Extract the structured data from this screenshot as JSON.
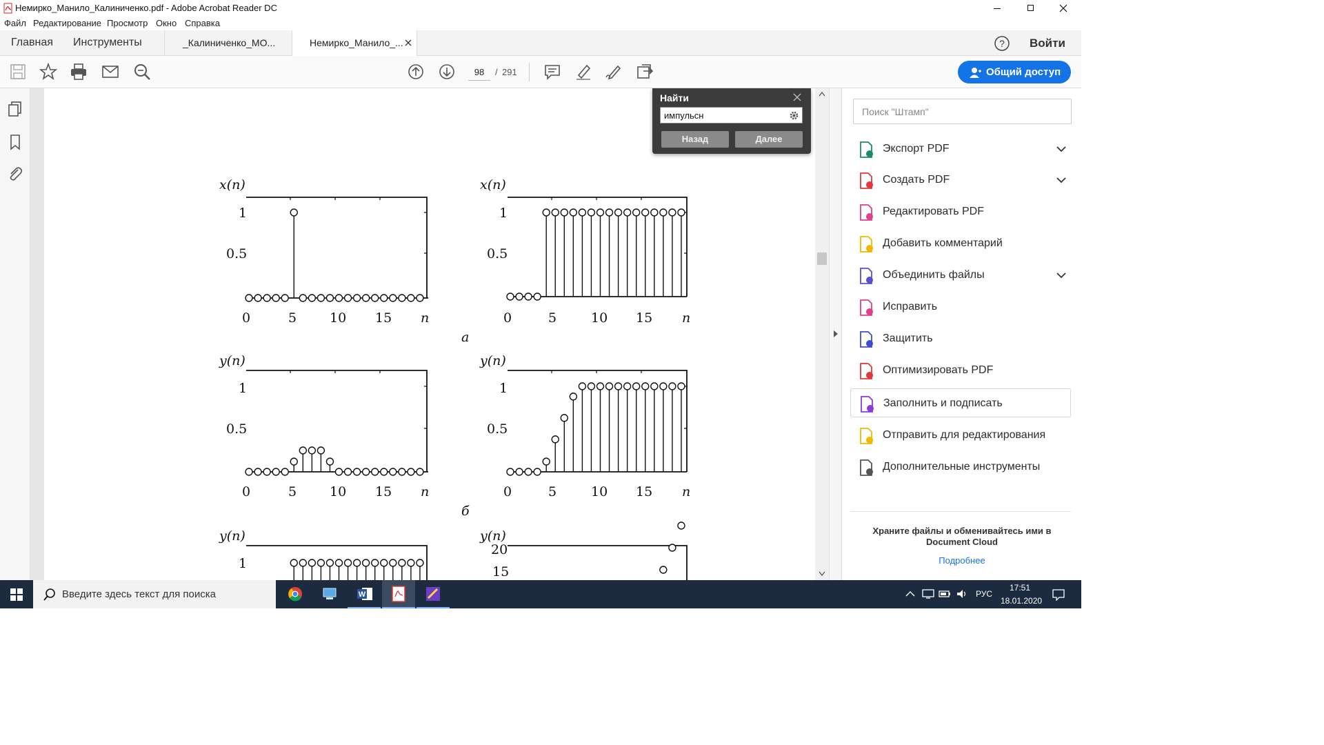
{
  "window": {
    "title": "Немирко_Манило_Калиниченко.pdf - Adobe Acrobat Reader DC"
  },
  "menu": [
    "Файл",
    "Редактирование",
    "Просмотр",
    "Окно",
    "Справка"
  ],
  "tabs": {
    "home": "Главная",
    "tools": "Инструменты",
    "doc1": "_Калиниченко_МО...",
    "doc2": "Немирко_Манило_...",
    "signin": "Войти"
  },
  "toolbar": {
    "page_current": "98",
    "page_sep": "/",
    "page_total": "291",
    "share_label": "Общий доступ"
  },
  "find": {
    "title": "Найти",
    "query": "импульсн",
    "prev": "Назад",
    "next": "Далее"
  },
  "rightpanel": {
    "search_placeholder": "Поиск \"Штамп\"",
    "tools": [
      {
        "label": "Экспорт PDF",
        "icon": "export-pdf-icon",
        "color": "#1b8a6b"
      },
      {
        "label": "Создать PDF",
        "icon": "create-pdf-icon",
        "color": "#e0383c"
      },
      {
        "label": "Редактировать PDF",
        "icon": "edit-pdf-icon",
        "color": "#e03f8e"
      },
      {
        "label": "Добавить комментарий",
        "icon": "comment-icon",
        "color": "#f0b800"
      },
      {
        "label": "Объединить файлы",
        "icon": "combine-files-icon",
        "color": "#5a4fcf"
      },
      {
        "label": "Исправить",
        "icon": "fix-icon",
        "color": "#e03f8e"
      },
      {
        "label": "Защитить",
        "icon": "protect-icon",
        "color": "#3d4fcf"
      },
      {
        "label": "Оптимизировать PDF",
        "icon": "optimize-pdf-icon",
        "color": "#e0383c"
      },
      {
        "label": "Заполнить и подписать",
        "icon": "fill-sign-icon",
        "color": "#8a3ed6"
      },
      {
        "label": "Отправить для редактирования",
        "icon": "send-review-icon",
        "color": "#f0b800"
      },
      {
        "label": "Дополнительные инструменты",
        "icon": "more-tools-icon",
        "color": "#555555"
      }
    ],
    "cloud_text": "Храните файлы и обменивайтесь ими в Document Cloud",
    "cloud_link": "Подробнее"
  },
  "taskbar": {
    "search_placeholder": "Введите здесь текст для поиска",
    "lang": "РУС",
    "time": "17:51",
    "date": "18.01.2020"
  },
  "document": {
    "caption_a": "а",
    "caption_b": "б",
    "xtick_labels": [
      "0",
      "5",
      "10",
      "15",
      "n"
    ],
    "plots": [
      {
        "ylabel": "x(n)",
        "yticks": [
          "1",
          "0.5"
        ],
        "x": [
          0,
          1,
          2,
          3,
          4,
          5,
          6,
          7,
          8,
          9,
          10,
          11,
          12,
          13,
          14,
          15,
          16,
          17,
          18,
          19
        ],
        "values": [
          0,
          0,
          0,
          0,
          0,
          1,
          0,
          0,
          0,
          0,
          0,
          0,
          0,
          0,
          0,
          0,
          0,
          0,
          0,
          0
        ]
      },
      {
        "ylabel": "x(n)",
        "yticks": [
          "1",
          "0.5"
        ],
        "x": [
          0,
          1,
          2,
          3,
          4,
          5,
          6,
          7,
          8,
          9,
          10,
          11,
          12,
          13,
          14,
          15,
          16,
          17,
          18,
          19
        ],
        "values": [
          0,
          0,
          0,
          0,
          1,
          1,
          1,
          1,
          1,
          1,
          1,
          1,
          1,
          1,
          1,
          1,
          1,
          1,
          1,
          1
        ]
      },
      {
        "ylabel": "y(n)",
        "yticks": [
          "1",
          "0.5"
        ],
        "x": [
          0,
          1,
          2,
          3,
          4,
          5,
          6,
          7,
          8,
          9,
          10,
          11,
          12,
          13,
          14,
          15,
          16,
          17,
          18,
          19
        ],
        "values": [
          0,
          0,
          0,
          0,
          0,
          0.12,
          0.25,
          0.25,
          0.25,
          0.12,
          0,
          0,
          0,
          0,
          0,
          0,
          0,
          0,
          0,
          0
        ]
      },
      {
        "ylabel": "y(n)",
        "yticks": [
          "1",
          "0.5"
        ],
        "x": [
          0,
          1,
          2,
          3,
          4,
          5,
          6,
          7,
          8,
          9,
          10,
          11,
          12,
          13,
          14,
          15,
          16,
          17,
          18,
          19
        ],
        "values": [
          0,
          0,
          0,
          0,
          0.12,
          0.38,
          0.63,
          0.88,
          1,
          1,
          1,
          1,
          1,
          1,
          1,
          1,
          1,
          1,
          1,
          1
        ]
      },
      {
        "ylabel": "y(n)",
        "yticks": [
          "1"
        ],
        "x": [
          5,
          6,
          7,
          8,
          9,
          10,
          11,
          12,
          13,
          14,
          15,
          16,
          17,
          18,
          19
        ],
        "values": [
          1,
          1,
          1,
          1,
          1,
          1,
          1,
          1,
          1,
          1,
          1,
          1,
          1,
          1,
          1
        ]
      },
      {
        "ylabel": "y(n)",
        "yticks": [
          "20",
          "15"
        ],
        "x": [
          17,
          18,
          19
        ],
        "values": [
          15,
          16,
          17
        ]
      }
    ]
  }
}
